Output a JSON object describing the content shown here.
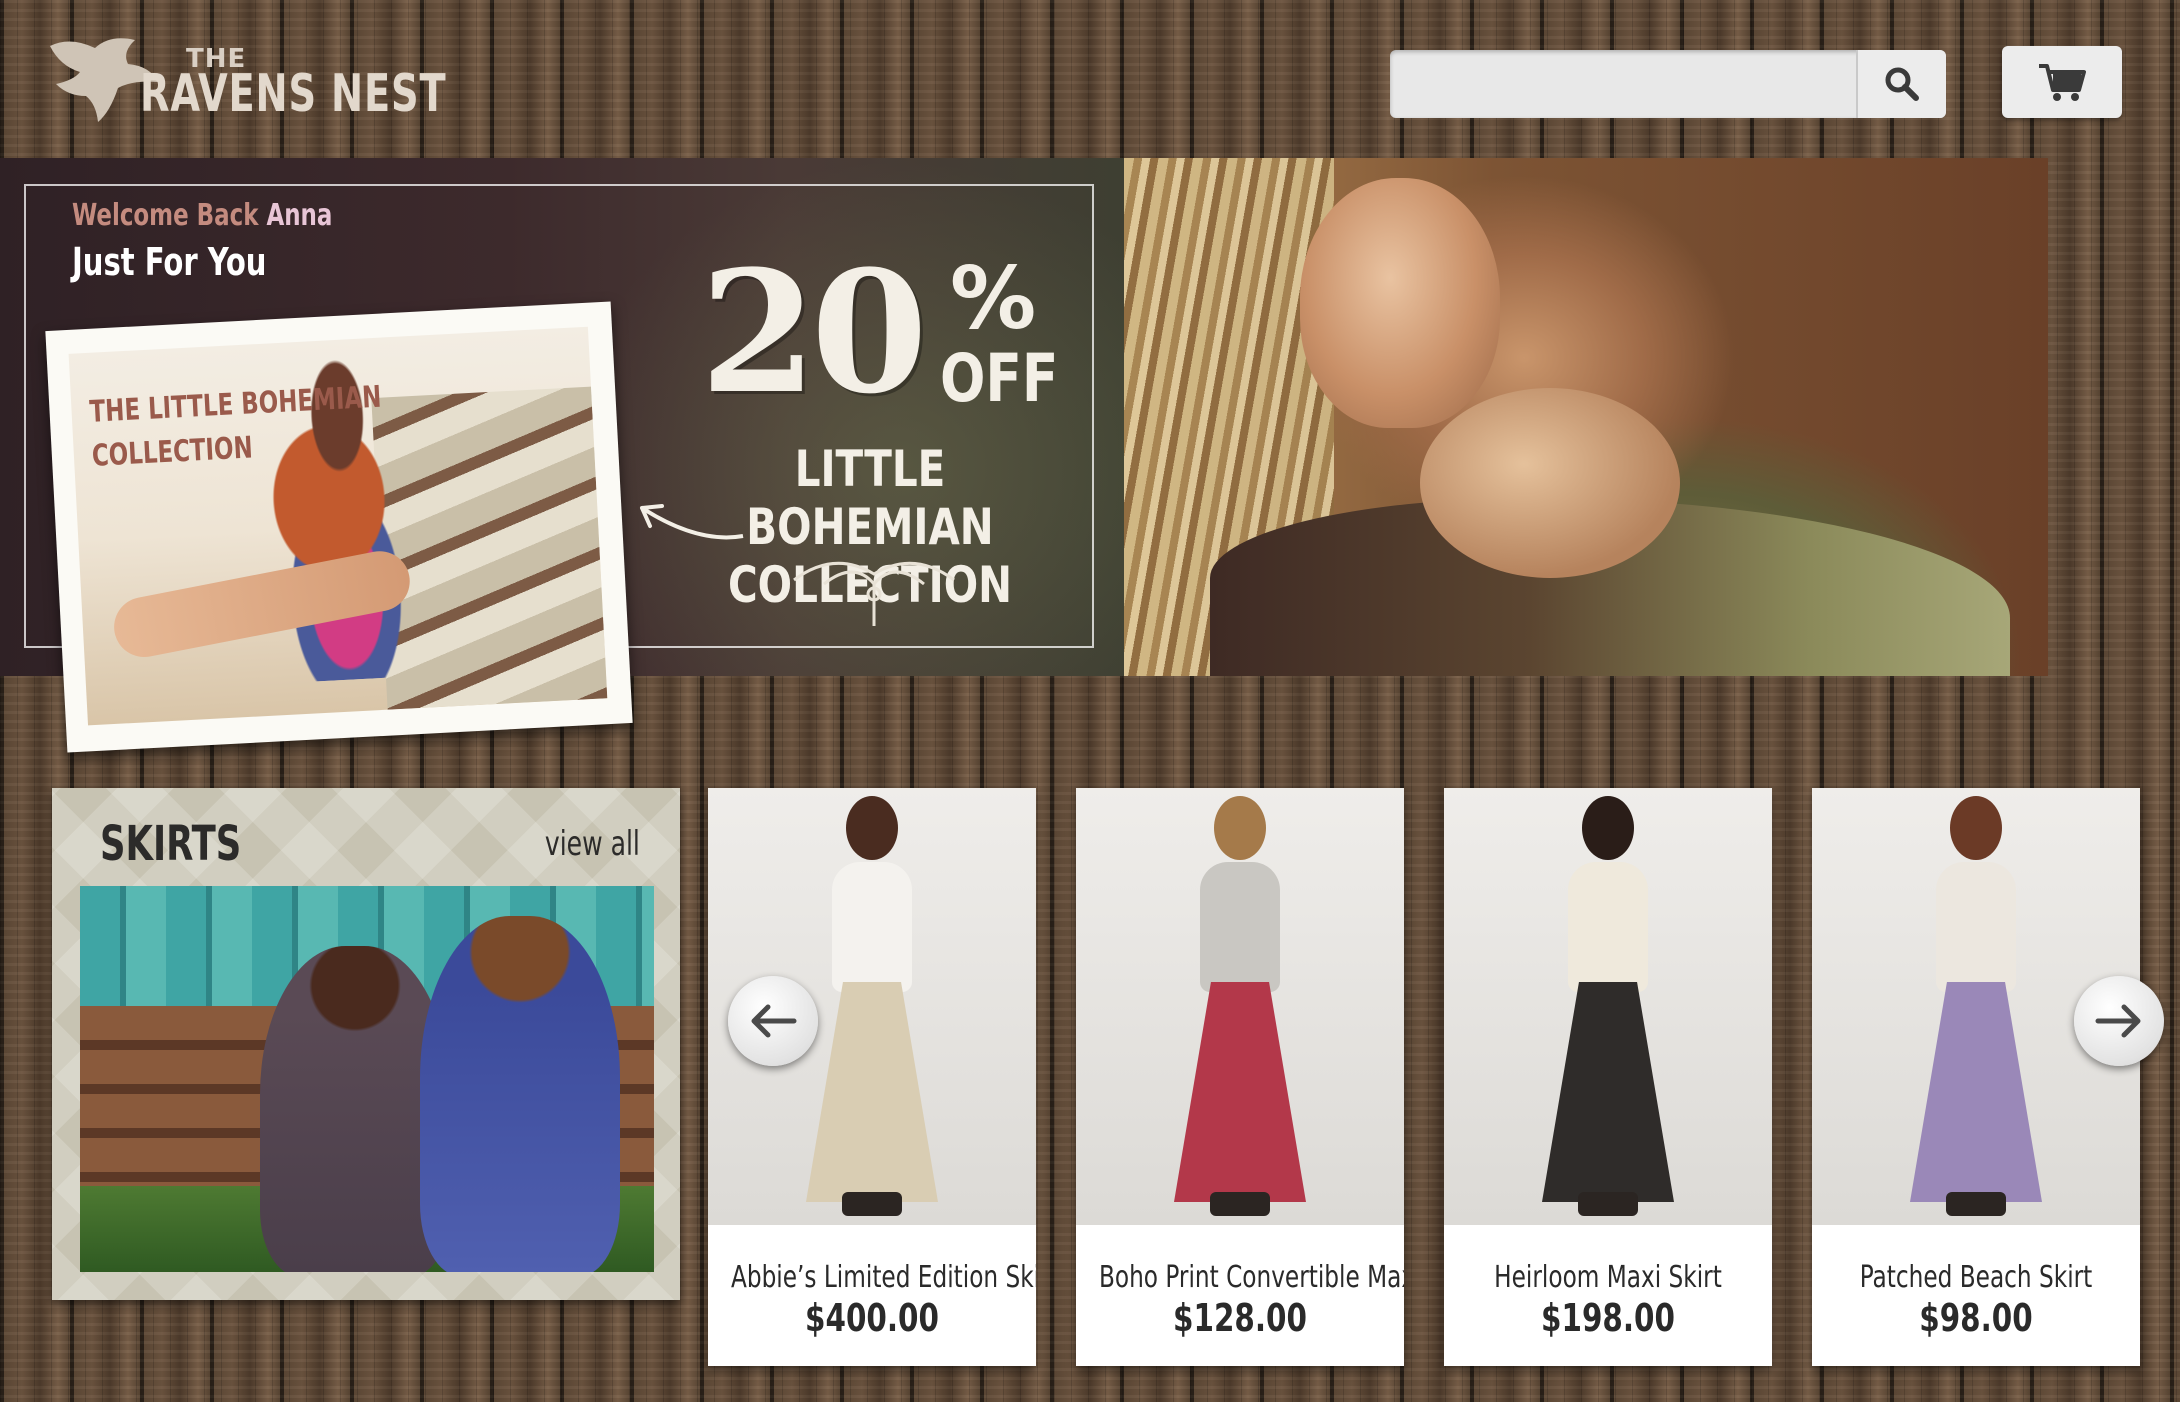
{
  "brand": {
    "the": "THE",
    "name": "RAVENS NEST"
  },
  "search": {
    "value": "",
    "placeholder": "",
    "icon": "search-icon"
  },
  "cart": {
    "icon": "cart-icon"
  },
  "banner": {
    "welcome_prefix": "Welcome Back",
    "user_name": "Anna",
    "subtitle": "Just For You",
    "polaroid_title_line1": "THE LITTLE BOHEMIAN",
    "polaroid_title_line2": "COLLECTION",
    "promo_number": "20",
    "promo_percent": "%",
    "promo_off": "OFF",
    "promo_line1": "LITTLE BOHEMIAN",
    "promo_line2": "COLLECTION"
  },
  "skirts_section": {
    "title": "SKIRTS",
    "view_all": "view all"
  },
  "carousel": {
    "prev_icon": "arrow-left-icon",
    "next_icon": "arrow-right-icon",
    "products": [
      {
        "name": "Abbie’s Limited Edition Skirt",
        "price": "$400.00",
        "top_color": "#f4f2ee",
        "skirt_color": "#d9cdb3",
        "hair_color": "#4a2c20"
      },
      {
        "name": "Boho Print Convertible Maxi",
        "price": "$128.00",
        "top_color": "#c9c7c2",
        "skirt_color": "#b3384a",
        "hair_color": "#a57a4a"
      },
      {
        "name": "Heirloom Maxi Skirt",
        "price": "$198.00",
        "top_color": "#efe9dc",
        "skirt_color": "#2f2c2a",
        "hair_color": "#2a1d18"
      },
      {
        "name": "Patched Beach Skirt",
        "price": "$98.00",
        "top_color": "#ece7df",
        "skirt_color": "#9a88b8",
        "hair_color": "#6b3a26"
      }
    ]
  },
  "colors": {
    "accent_welcome": "#c48b7f",
    "user_name": "#e8c5d6",
    "wood": "#5a4634"
  }
}
